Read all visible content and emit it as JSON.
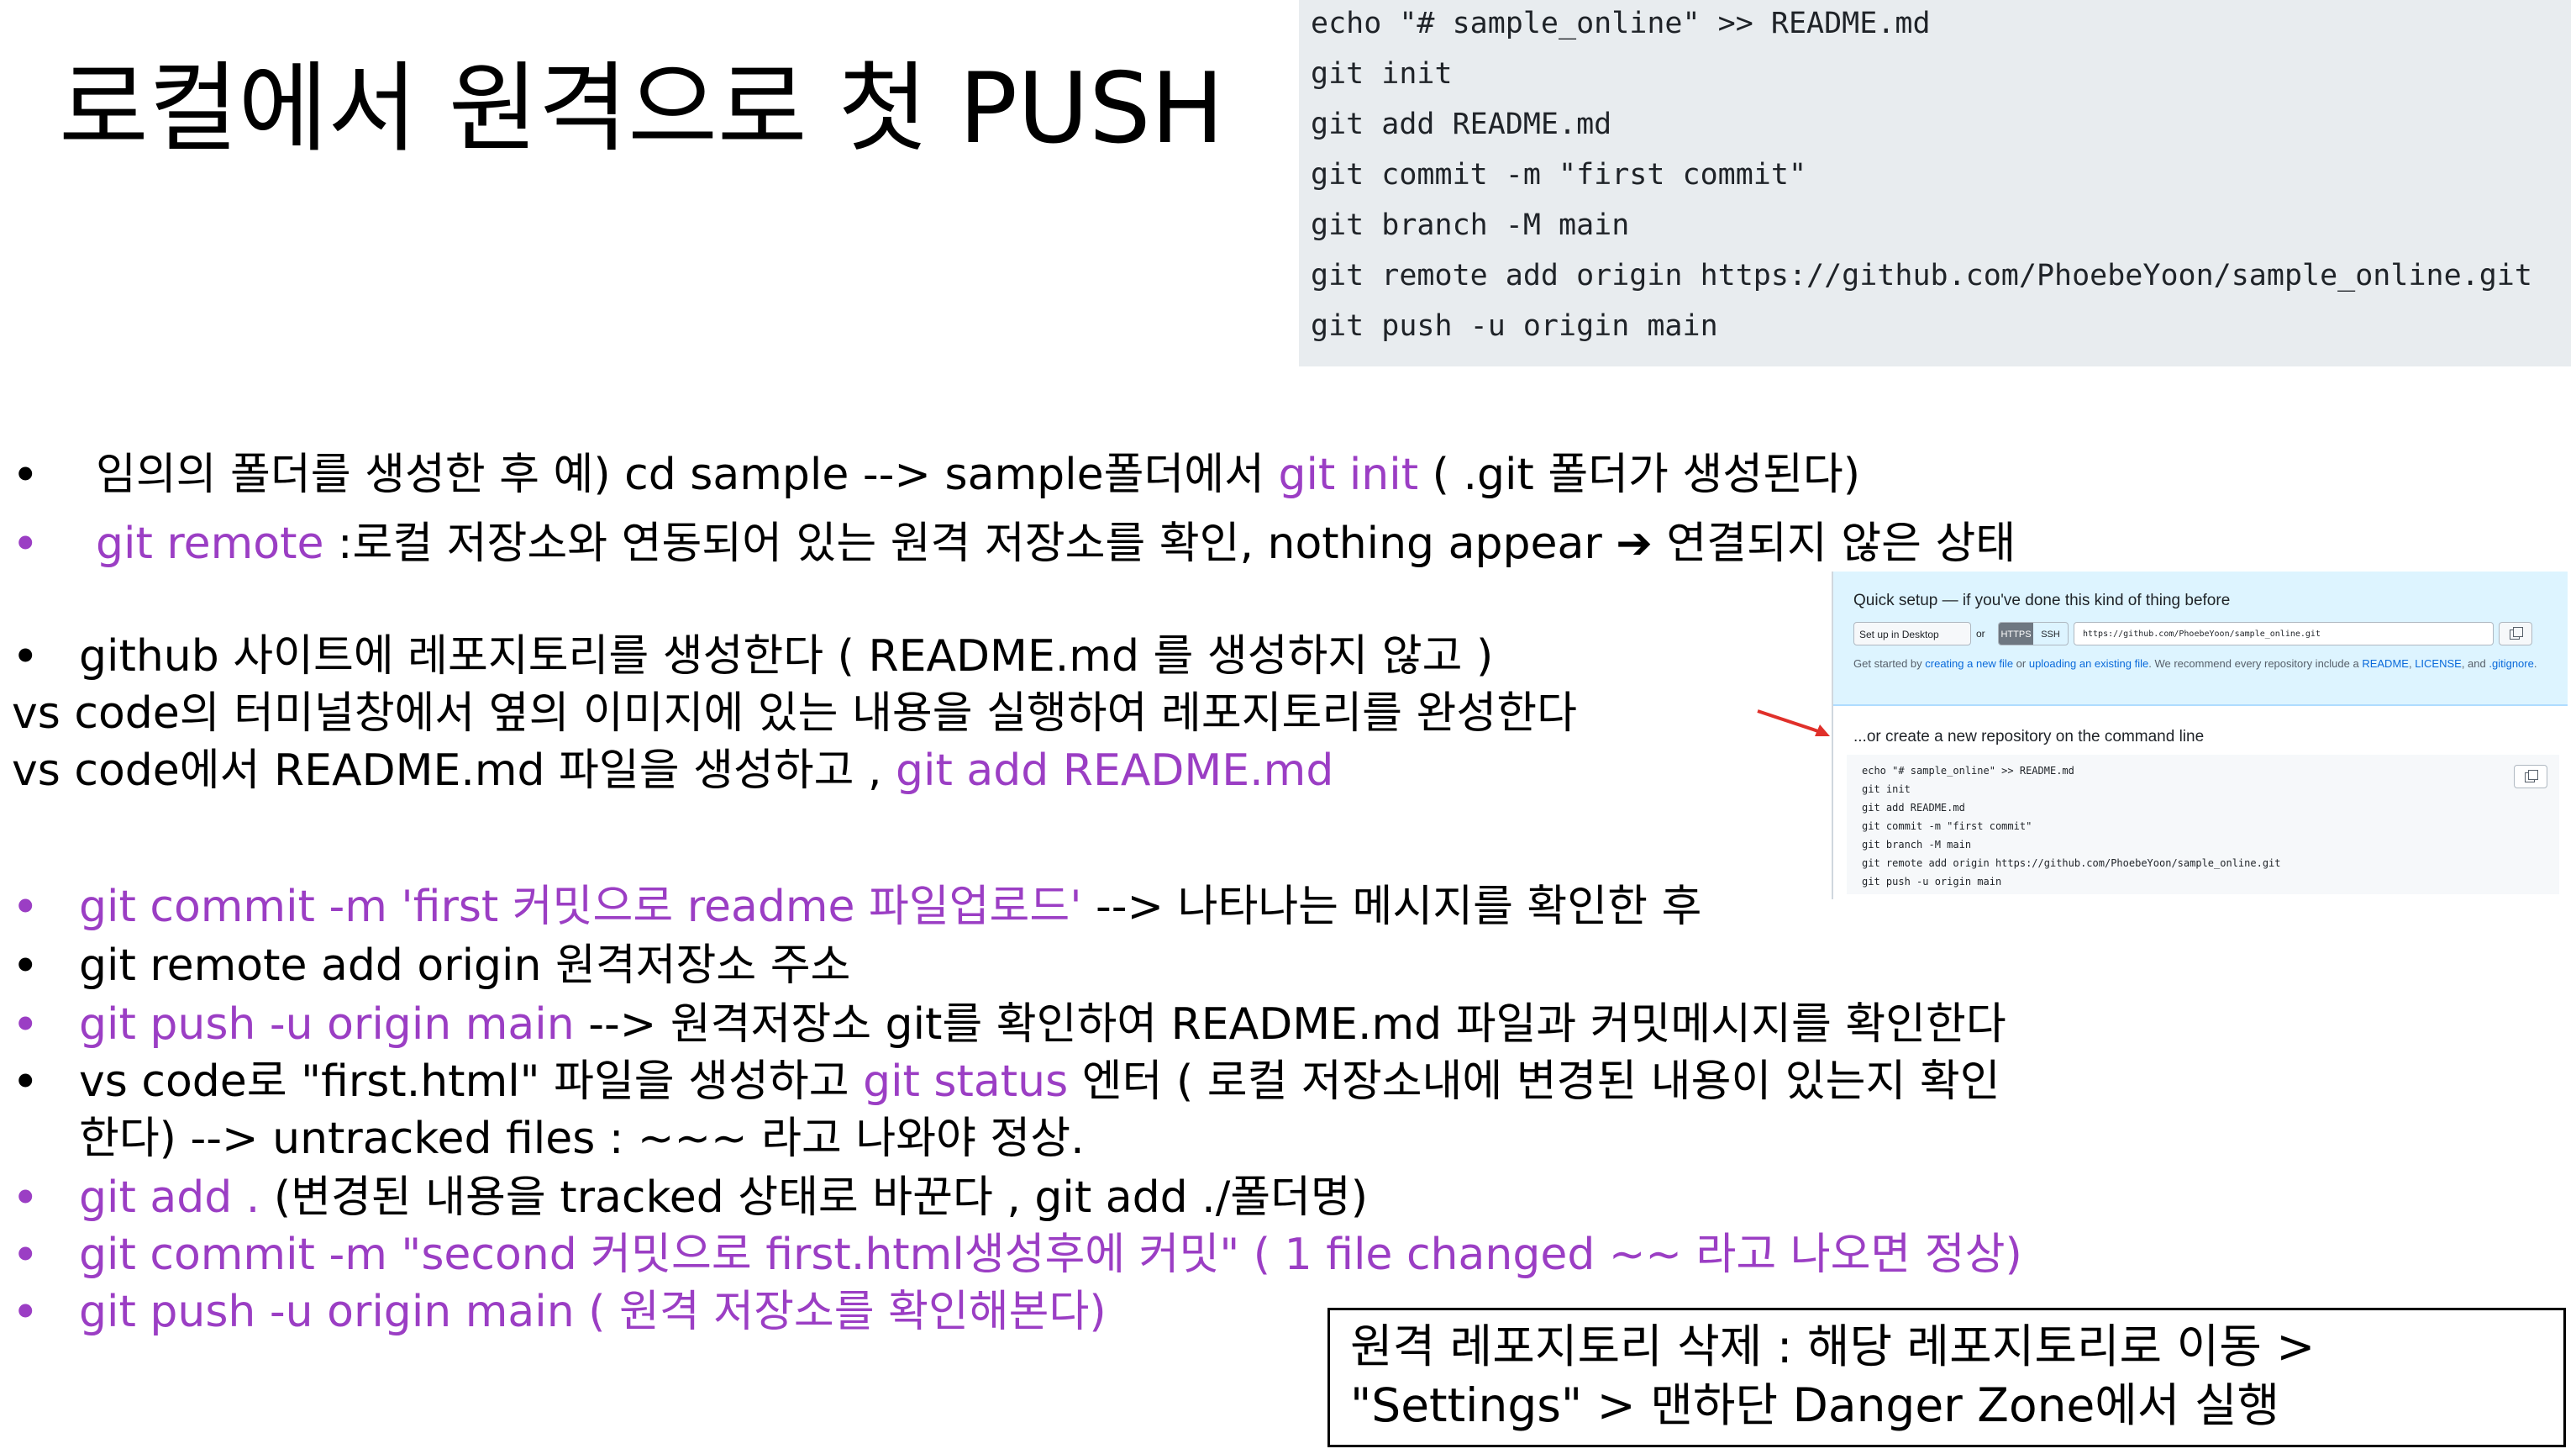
{
  "title": "로컬에서 원격으로 첫 PUSH",
  "code_block": {
    "lines": [
      "echo \"# sample_online\" >> README.md",
      "git init",
      "git add README.md",
      "git commit -m \"first commit\"",
      "git branch -M main",
      "git remote add origin https://github.com/PhoebeYoon/sample_online.git",
      "git push -u origin main"
    ]
  },
  "steps_top": [
    {
      "bullet_color": "#000000",
      "pre": "임의의 폴더를 생성한 후 예) cd sample  -->  sample폴더에서 ",
      "highlight": "git init",
      "post": " ( .git 폴더가 생성된다)"
    },
    {
      "bullet_color": "#9b3ec4",
      "highlight": "git remote",
      "post": " :로컬 저장소와 연동되어 있는 원격 저장소를 확인, nothing appear ➔ 연결되지 않은 상태"
    }
  ],
  "github_section": {
    "line1": "github 사이트에 레포지토리를 생성한다  ( README.md 를 생성하지 않고 )",
    "line2": "vs code의 터미널창에서  옆의 이미지에 있는 내용을 실행하여  레포지토리를 완성한다",
    "line3_pre": "vs code에서 README.md 파일을 생성하고 ,  ",
    "line3_highlight": "git add README.md"
  },
  "steps_bottom": [
    {
      "purple": "git commit -m 'first  커밋으로 readme 파일업로드'",
      "rest": " --> 나타나는 메시지를 확인한 후"
    },
    {
      "purple": "",
      "rest": "git  remote   add  origin   원격저장소 주소"
    },
    {
      "purple": "git push -u origin main",
      "rest": "  --> 원격저장소 git를 확인하여  README.md 파일과 커밋메시지를 확인한다"
    },
    {
      "pre": "vs code로 \"first.html\" 파일을 생성하고 ",
      "purple": "git status",
      "rest": " 엔터 ( 로컬 저장소내에 변경된 내용이 있는지 확인",
      "cont": "한다) --> untracked files : ~~~ 라고 나와야 정상."
    },
    {
      "purple": "git add .",
      "rest": "  (변경된 내용을 tracked 상태로 바꾼다 , git add ./폴더명)"
    },
    {
      "purple": "git commit -m \"second 커밋으로 first.html생성후에 커밋\"  ( 1 file changed ~~ 라고 나오면 정상)",
      "rest": ""
    },
    {
      "purple": "git push -u origin main ( 원격 저장소를 확인해본다)",
      "rest": ""
    }
  ],
  "note_box": {
    "line1": "원격 레포지토리 삭제  : 해당 레포지토리로 이동 >",
    "line2": "\"Settings\" > 맨하단 Danger Zone에서 실행"
  },
  "github_thumbnail": {
    "quick_setup_title": "Quick setup — if you've done this kind of thing before",
    "setup_desktop_label": "Set up in Desktop",
    "or_label": "or",
    "https_label": "HTTPS",
    "ssh_label": "SSH",
    "url": "https://github.com/PhoebeYoon/sample_online.git",
    "note_pre": "Get started by ",
    "note_link1": "creating a new file",
    "note_mid": " or ",
    "note_link2": "uploading an existing file",
    "note_post": ". We recommend every repository include a ",
    "note_link3": "README",
    "note_sep1": ", ",
    "note_link4": "LICENSE",
    "note_sep2": ", and ",
    "note_link5": ".gitignore",
    "note_end": ".",
    "cmdline_title": "...or create a new repository on the command line",
    "cmd_lines": [
      "echo \"# sample_online\" >> README.md",
      "git init",
      "git add README.md",
      "git commit -m \"first commit\"",
      "git branch -M main",
      "git remote add origin https://github.com/PhoebeYoon/sample_online.git",
      "git push -u origin main"
    ]
  },
  "colors": {
    "accent_purple": "#9b3ec4",
    "code_bg": "#e8ecef",
    "arrow_red": "#e0302a"
  }
}
